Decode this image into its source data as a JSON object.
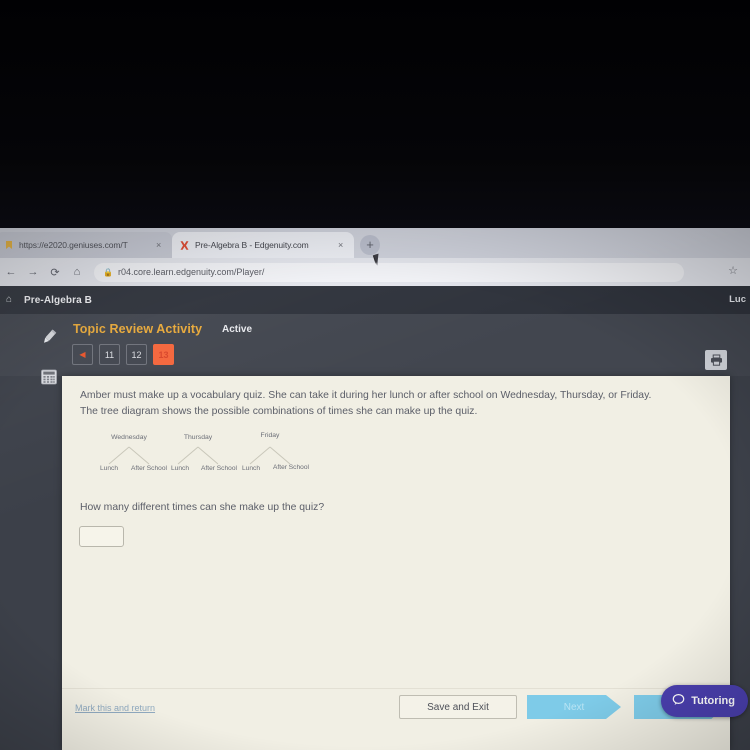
{
  "browser": {
    "tabs": [
      {
        "title": "https://e2020.geniuses.com/T",
        "favicon": "bookmark-icon",
        "active": false,
        "close_label": "×"
      },
      {
        "title": "Pre-Algebra B - Edgenuity.com",
        "favicon": "edgenuity-x-icon",
        "active": true,
        "close_label": "×"
      }
    ],
    "new_tab_label": "+",
    "nav": {
      "back_label": "←",
      "forward_label": "→",
      "reload_label": "⟳",
      "home_label": "⌂"
    },
    "omnibox": {
      "url": "r04.core.learn.edgenuity.com/Player/",
      "lock_icon": "lock-icon"
    },
    "bookmark_star_label": "☆"
  },
  "app": {
    "home_icon": "home-icon",
    "course_name": "Pre-Algebra B",
    "user_name": "Luc",
    "activity_title": "Topic Review Activity",
    "activity_status": "Active",
    "question_nav": {
      "prev_label": "◀",
      "buttons": [
        {
          "label": "11",
          "current": false
        },
        {
          "label": "12",
          "current": false
        },
        {
          "label": "13",
          "current": true
        }
      ]
    },
    "tools": [
      {
        "icon": "highlighter-pencil-icon",
        "name": "highlighter-tool"
      },
      {
        "icon": "calculator-icon",
        "name": "calculator-tool"
      }
    ],
    "print_icon": "printer-icon"
  },
  "question": {
    "stem_line1": "Amber must make up a vocabulary quiz. She can take it during her lunch or after school on Wednesday, Thursday, or Friday.",
    "stem_line2": "The tree diagram shows the possible combinations of times she can make up the quiz.",
    "prompt": "How many different times can she make up the quiz?",
    "answer_value": "",
    "answer_placeholder": ""
  },
  "tree_diagram": {
    "branches": [
      {
        "day": "Wednesday",
        "children": [
          "Lunch",
          "After School"
        ]
      },
      {
        "day": "Thursday",
        "children": [
          "Lunch",
          "After School"
        ]
      },
      {
        "day": "Friday",
        "children": [
          "Lunch",
          "After School"
        ]
      }
    ]
  },
  "footer": {
    "mark_return_label": "Mark this and return",
    "save_exit_label": "Save and Exit",
    "next_label": "Next",
    "tutoring_label": "Tutoring",
    "tutoring_icon": "chat-bubble-icon",
    "tutoring_color": "#4a3fae",
    "next_color": "#7ecbe8",
    "accent_color": "#e8a93a",
    "current_question_color": "#f4663c"
  }
}
